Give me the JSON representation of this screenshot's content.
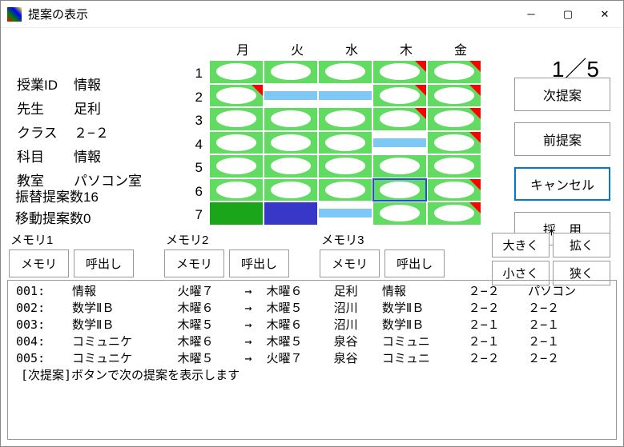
{
  "window": {
    "title": "提案の表示"
  },
  "days": [
    "月",
    "火",
    "水",
    "木",
    "金"
  ],
  "periods": [
    "1",
    "2",
    "3",
    "4",
    "5",
    "6",
    "7"
  ],
  "info": {
    "labels": {
      "id": "授業ID",
      "teacher": "先生",
      "class": "クラス",
      "subject": "科目",
      "room": "教室"
    },
    "values": {
      "id": "情報",
      "teacher": "足利",
      "class": "２−２",
      "subject": "情報",
      "room": "パソコン室"
    }
  },
  "stats": {
    "swap_label": "振替提案数",
    "swap_value": "16",
    "move_label": "移動提案数",
    "move_value": "0"
  },
  "pager": "1／5",
  "buttons": {
    "next": "次提案",
    "prev": "前提案",
    "cancel": "キャンセル",
    "adopt": "採　用"
  },
  "mem": {
    "g1": "メモリ1",
    "g2": "メモリ2",
    "g3": "メモリ3",
    "save": "メモリ",
    "load": "呼出し"
  },
  "size": {
    "big": "大きく",
    "wide": "拡く",
    "small": "小さく",
    "narrow": "狭く"
  },
  "grid": [
    [
      "oval",
      "oval",
      "oval",
      "tri",
      "tri"
    ],
    [
      "tri",
      "stripe",
      "stripe",
      "tri",
      "tri"
    ],
    [
      "oval",
      "oval",
      "oval",
      "tri",
      "tri"
    ],
    [
      "oval",
      "oval",
      "oval",
      "stripe",
      "tri"
    ],
    [
      "oval",
      "oval",
      "oval",
      "oval",
      "oval"
    ],
    [
      "oval",
      "oval",
      "oval",
      "oval_sel",
      "tri"
    ],
    [
      "solid-g",
      "solid-b",
      "stripe",
      "oval",
      "tri"
    ]
  ],
  "list": {
    "rows": [
      {
        "n": "001",
        "subj": "情報",
        "from": "火曜７",
        "arrow": "→",
        "to": "木曜６",
        "teacher": "足利",
        "subj2": "情報",
        "cls": "２−２",
        "room": "パソコン"
      },
      {
        "n": "002",
        "subj": "数学ⅡＢ",
        "from": "木曜６",
        "arrow": "→",
        "to": "木曜５",
        "teacher": "沼川",
        "subj2": "数学ⅡＢ",
        "cls": "２−２",
        "room": "２−２"
      },
      {
        "n": "003",
        "subj": "数学ⅡＢ",
        "from": "木曜５",
        "arrow": "→",
        "to": "木曜６",
        "teacher": "沼川",
        "subj2": "数学ⅡＢ",
        "cls": "２−１",
        "room": "２−１"
      },
      {
        "n": "004",
        "subj": "コミュニケ",
        "from": "木曜６",
        "arrow": "→",
        "to": "木曜５",
        "teacher": "泉谷",
        "subj2": "コミュニ",
        "cls": "２−１",
        "room": "２−１"
      },
      {
        "n": "005",
        "subj": "コミュニケ",
        "from": "木曜５",
        "arrow": "→",
        "to": "火曜７",
        "teacher": "泉谷",
        "subj2": "コミュニ",
        "cls": "２−２",
        "room": "２−２"
      }
    ],
    "hint": "[次提案]ボタンで次の提案を表示します"
  }
}
